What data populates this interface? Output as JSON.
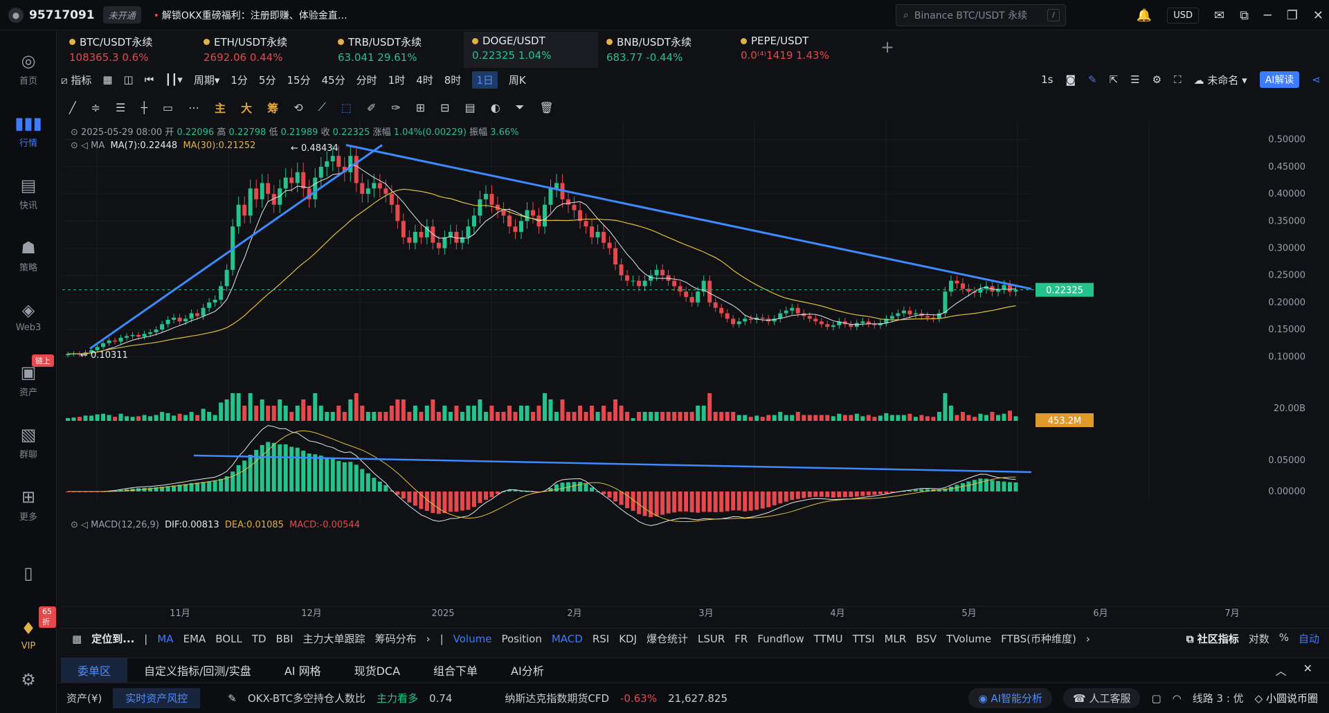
{
  "topbar": {
    "uid": "95717091",
    "not_open": "未开通",
    "promo": "解锁OKX重磅福利：注册即赚、体验金直…",
    "search_placeholder": "Binance BTC/USDT 永续",
    "currency": "USD"
  },
  "sidebar": {
    "items": [
      {
        "label": "首页",
        "icon": "home-icon"
      },
      {
        "label": "行情",
        "icon": "market-icon"
      },
      {
        "label": "快讯",
        "icon": "news-icon"
      },
      {
        "label": "策略",
        "icon": "strategy-icon"
      },
      {
        "label": "Web3",
        "icon": "web3-icon"
      },
      {
        "label": "资产",
        "icon": "wallet-icon"
      },
      {
        "label": "群聊",
        "icon": "chat-icon"
      },
      {
        "label": "更多",
        "icon": "more-icon"
      }
    ],
    "chain_badge": "链上",
    "vip_label": "VIP",
    "vip_badge": "65折"
  },
  "tabs": [
    {
      "name": "BTC/USDT永续",
      "price": "108365.3",
      "change": "0.6%",
      "dir": "down"
    },
    {
      "name": "ETH/USDT永续",
      "price": "2692.06",
      "change": "0.44%",
      "dir": "down"
    },
    {
      "name": "TRB/USDT永续",
      "price": "63.041",
      "change": "29.61%",
      "dir": "up"
    },
    {
      "name": "DOGE/USDT",
      "price": "0.22325",
      "change": "1.04%",
      "dir": "up"
    },
    {
      "name": "BNB/USDT永续",
      "price": "683.77",
      "change": "-0.44%",
      "dir": "up"
    },
    {
      "name": "PEPE/USDT",
      "price": "0.0⁽⁴⁾1419",
      "change": "1.43%",
      "dir": "down"
    }
  ],
  "toolbar1": {
    "indicator": "指标",
    "period": "周期",
    "intervals": [
      "1分",
      "5分",
      "15分",
      "45分",
      "分时",
      "1时",
      "4时",
      "8时",
      "1日",
      "周K"
    ],
    "selected": "1日",
    "right_1s": "1s",
    "unnamed": "未命名",
    "ai_label": "AI解读"
  },
  "toolbar2": {
    "items": [
      "主",
      "大",
      "筹"
    ]
  },
  "ohlc": {
    "date": "2025-05-29 08:00",
    "open_label": "开",
    "open": "0.22096",
    "high_label": "高",
    "high": "0.22798",
    "low_label": "低",
    "low": "0.21989",
    "close_label": "收",
    "close": "0.22325",
    "chg_label": "涨幅",
    "chg": "1.04%(0.00229)",
    "amp_label": "振幅",
    "amp": "3.66%"
  },
  "ma": {
    "label": "MA",
    "ma7": "MA(7):0.22448",
    "ma30": "MA(30):0.21252"
  },
  "macd": {
    "label": "MACD(12,26,9)",
    "dif": "DIF:0.00813",
    "dea": "DEA:0.01085",
    "macd": "MACD:-0.00544"
  },
  "chart_data": {
    "type": "candlestick",
    "y_ticks": [
      "0.50000",
      "0.45000",
      "0.40000",
      "0.35000",
      "0.30000",
      "0.25000",
      "0.20000",
      "0.15000",
      "0.10000"
    ],
    "ylim": [
      0.08,
      0.52
    ],
    "x_ticks": [
      "11月",
      "12月",
      "2025",
      "2月",
      "3月",
      "4月",
      "5月",
      "6月",
      "7月"
    ],
    "current_price": "0.22325",
    "high_annotation": "0.48434",
    "low_annotation": "0.10311",
    "volume_tick": "20.00B",
    "volume_value": "453.2M",
    "macd_ticks": [
      "0.05000",
      "0.00000"
    ],
    "close_series": [
      0.105,
      0.106,
      0.104,
      0.108,
      0.112,
      0.118,
      0.125,
      0.13,
      0.128,
      0.135,
      0.138,
      0.14,
      0.137,
      0.142,
      0.145,
      0.15,
      0.16,
      0.168,
      0.172,
      0.165,
      0.17,
      0.18,
      0.175,
      0.19,
      0.2,
      0.205,
      0.23,
      0.26,
      0.34,
      0.38,
      0.36,
      0.41,
      0.39,
      0.42,
      0.4,
      0.38,
      0.41,
      0.43,
      0.42,
      0.44,
      0.41,
      0.39,
      0.43,
      0.45,
      0.46,
      0.47,
      0.45,
      0.44,
      0.47,
      0.42,
      0.4,
      0.41,
      0.42,
      0.41,
      0.4,
      0.38,
      0.35,
      0.32,
      0.31,
      0.33,
      0.32,
      0.34,
      0.31,
      0.3,
      0.32,
      0.33,
      0.31,
      0.32,
      0.34,
      0.36,
      0.39,
      0.4,
      0.38,
      0.37,
      0.36,
      0.34,
      0.33,
      0.35,
      0.37,
      0.36,
      0.34,
      0.38,
      0.41,
      0.42,
      0.39,
      0.38,
      0.37,
      0.35,
      0.34,
      0.32,
      0.33,
      0.31,
      0.3,
      0.27,
      0.25,
      0.24,
      0.24,
      0.23,
      0.24,
      0.25,
      0.26,
      0.25,
      0.24,
      0.23,
      0.22,
      0.21,
      0.2,
      0.22,
      0.24,
      0.2,
      0.19,
      0.18,
      0.17,
      0.16,
      0.165,
      0.17,
      0.168,
      0.172,
      0.17,
      0.165,
      0.17,
      0.18,
      0.185,
      0.19,
      0.18,
      0.175,
      0.17,
      0.165,
      0.16,
      0.155,
      0.158,
      0.165,
      0.16,
      0.155,
      0.162,
      0.165,
      0.16,
      0.158,
      0.162,
      0.17,
      0.175,
      0.18,
      0.185,
      0.178,
      0.18,
      0.175,
      0.172,
      0.17,
      0.18,
      0.22,
      0.24,
      0.235,
      0.225,
      0.22,
      0.218,
      0.225,
      0.23,
      0.22,
      0.225,
      0.232,
      0.22,
      0.223
    ]
  },
  "indicators": {
    "locate": "定位到...",
    "main": [
      "MA",
      "EMA",
      "BOLL",
      "TD",
      "BBI",
      "主力大单跟踪",
      "筹码分布"
    ],
    "sub": [
      "Volume",
      "Position",
      "MACD",
      "RSI",
      "KDJ",
      "爆仓统计",
      "LSUR",
      "FR",
      "Fundflow",
      "TTMU",
      "TTSI",
      "MLR",
      "BSV",
      "TVolume",
      "FTBS(币种维度)"
    ],
    "community": "社区指标",
    "log": "对数",
    "pct": "%",
    "auto": "自动"
  },
  "order_tabs": [
    "委单区",
    "自定义指标/回测/实盘",
    "AI 网格",
    "现货DCA",
    "组合下单",
    "AI分析"
  ],
  "statusbar": {
    "asset": "资产(¥)",
    "risk": "实时资产风控",
    "okx_text": "OKX-BTC多空持仓人数比",
    "okx_tag": "主力看多",
    "okx_val": "0.74",
    "nasdaq": "纳斯达克指数期货CFD",
    "nasdaq_chg": "-0.63%",
    "nasdaq_val": "21,627.825",
    "ai_analysis": "AI智能分析",
    "service": "人工客服",
    "line": "线路 3 : 优",
    "watermark": "小圆说币圈"
  }
}
